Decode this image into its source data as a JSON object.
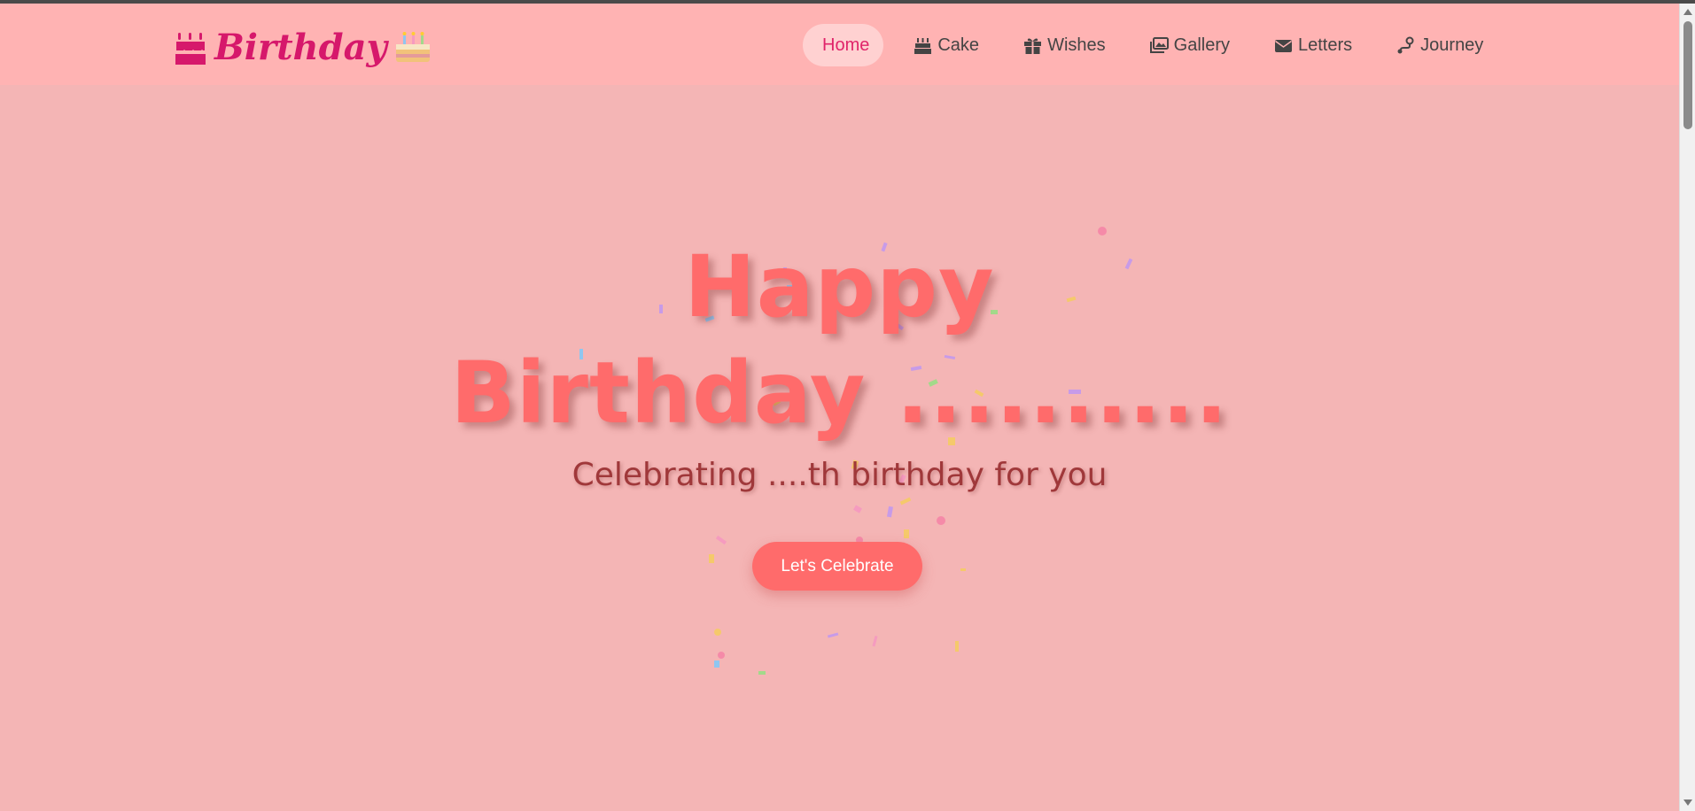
{
  "brand": {
    "text": "Birthday",
    "icon": "birthday-cake-icon",
    "emoji": "cake-emoji"
  },
  "nav": {
    "items": [
      {
        "label": "Home",
        "icon": "home",
        "active": true
      },
      {
        "label": "Cake",
        "icon": "cake-icon"
      },
      {
        "label": "Wishes",
        "icon": "gift-icon"
      },
      {
        "label": "Gallery",
        "icon": "images-icon"
      },
      {
        "label": "Letters",
        "icon": "envelope-icon"
      },
      {
        "label": "Journey",
        "icon": "route-icon"
      }
    ]
  },
  "hero": {
    "title_line1": "Happy",
    "title_line2": "Birthday ..........",
    "subtitle": "Celebrating ....th birthday for you",
    "cta_label": "Let's Celebrate"
  },
  "colors": {
    "background": "#f4b5b5",
    "navbar": "#ffb3b3",
    "accent": "#ff6b6b",
    "brand": "#d6186b",
    "active_pill": "#ffd1d1"
  }
}
